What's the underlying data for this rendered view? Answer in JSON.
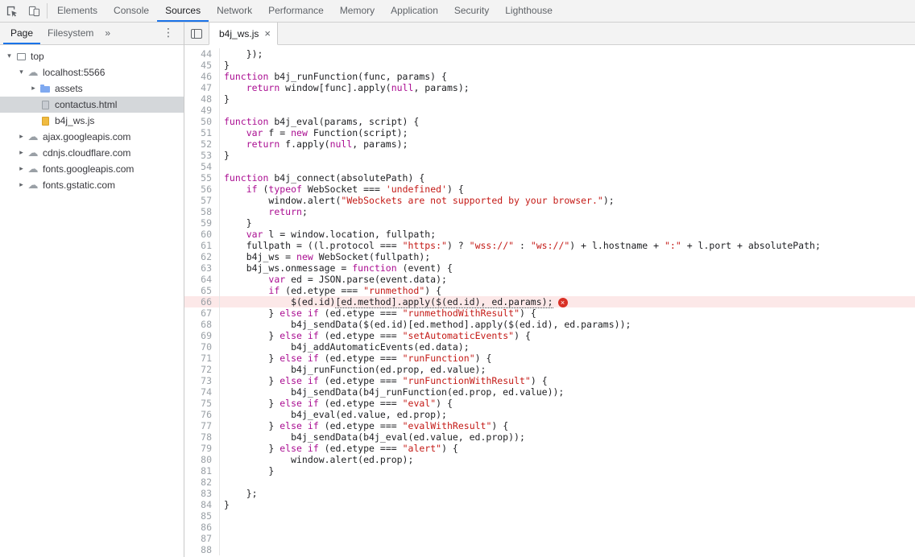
{
  "colors": {
    "accent": "#1a73e8",
    "keyword": "#aa0d91",
    "string": "#c41a16",
    "code_text": "#202124",
    "error_bg": "#fce8e8",
    "error_red": "#d93025",
    "selected_row": "#d4d7da"
  },
  "topbar": {
    "tabs": [
      "Elements",
      "Console",
      "Sources",
      "Network",
      "Performance",
      "Memory",
      "Application",
      "Security",
      "Lighthouse"
    ],
    "active_tab": "Sources"
  },
  "sidebar": {
    "tabs": [
      "Page",
      "Filesystem"
    ],
    "active_tab": "Page",
    "overflow_chevron": "»",
    "menu_glyph": "⋮",
    "tree": [
      {
        "label": "top",
        "level": 0,
        "expander": "open",
        "icon": "frame",
        "selected": false
      },
      {
        "label": "localhost:5566",
        "level": 1,
        "expander": "open",
        "icon": "cloud",
        "selected": false
      },
      {
        "label": "assets",
        "level": 2,
        "expander": "closed",
        "icon": "folder",
        "selected": false
      },
      {
        "label": "contactus.html",
        "level": 2,
        "expander": "none",
        "icon": "file-gray",
        "selected": true
      },
      {
        "label": "b4j_ws.js",
        "level": 2,
        "expander": "none",
        "icon": "file-yellow",
        "selected": false
      },
      {
        "label": "ajax.googleapis.com",
        "level": 1,
        "expander": "closed",
        "icon": "cloud",
        "selected": false
      },
      {
        "label": "cdnjs.cloudflare.com",
        "level": 1,
        "expander": "closed",
        "icon": "cloud",
        "selected": false
      },
      {
        "label": "fonts.googleapis.com",
        "level": 1,
        "expander": "closed",
        "icon": "cloud",
        "selected": false
      },
      {
        "label": "fonts.gstatic.com",
        "level": 1,
        "expander": "closed",
        "icon": "cloud",
        "selected": false
      }
    ]
  },
  "main": {
    "file_tab": {
      "label": "b4j_ws.js",
      "close": "×"
    }
  },
  "editor": {
    "error_line": 66,
    "error_glyph": "×",
    "lines": [
      {
        "n": 44,
        "seg": [
          [
            "p",
            "    });"
          ]
        ]
      },
      {
        "n": 45,
        "seg": [
          [
            "p",
            "}"
          ]
        ]
      },
      {
        "n": 46,
        "seg": [
          [
            "k",
            "function"
          ],
          [
            "p",
            " b4j_runFunction(func, params) {"
          ]
        ]
      },
      {
        "n": 47,
        "seg": [
          [
            "p",
            "    "
          ],
          [
            "k",
            "return"
          ],
          [
            "p",
            " window[func].apply("
          ],
          [
            "k",
            "null"
          ],
          [
            "p",
            ", params);"
          ]
        ]
      },
      {
        "n": 48,
        "seg": [
          [
            "p",
            "}"
          ]
        ]
      },
      {
        "n": 49,
        "seg": []
      },
      {
        "n": 50,
        "seg": [
          [
            "k",
            "function"
          ],
          [
            "p",
            " b4j_eval(params, script) {"
          ]
        ]
      },
      {
        "n": 51,
        "seg": [
          [
            "p",
            "    "
          ],
          [
            "k",
            "var"
          ],
          [
            "p",
            " f = "
          ],
          [
            "k",
            "new"
          ],
          [
            "p",
            " Function(script);"
          ]
        ]
      },
      {
        "n": 52,
        "seg": [
          [
            "p",
            "    "
          ],
          [
            "k",
            "return"
          ],
          [
            "p",
            " f.apply("
          ],
          [
            "k",
            "null"
          ],
          [
            "p",
            ", params);"
          ]
        ]
      },
      {
        "n": 53,
        "seg": [
          [
            "p",
            "}"
          ]
        ]
      },
      {
        "n": 54,
        "seg": []
      },
      {
        "n": 55,
        "seg": [
          [
            "k",
            "function"
          ],
          [
            "p",
            " b4j_connect(absolutePath) {"
          ]
        ]
      },
      {
        "n": 56,
        "seg": [
          [
            "p",
            "    "
          ],
          [
            "k",
            "if"
          ],
          [
            "p",
            " ("
          ],
          [
            "k",
            "typeof"
          ],
          [
            "p",
            " WebSocket === "
          ],
          [
            "s",
            "'undefined'"
          ],
          [
            "p",
            ") {"
          ]
        ]
      },
      {
        "n": 57,
        "seg": [
          [
            "p",
            "        window.alert("
          ],
          [
            "s",
            "\"WebSockets are not supported by your browser.\""
          ],
          [
            "p",
            ");"
          ]
        ]
      },
      {
        "n": 58,
        "seg": [
          [
            "p",
            "        "
          ],
          [
            "k",
            "return"
          ],
          [
            "p",
            ";"
          ]
        ]
      },
      {
        "n": 59,
        "seg": [
          [
            "p",
            "    }"
          ]
        ]
      },
      {
        "n": 60,
        "seg": [
          [
            "p",
            "    "
          ],
          [
            "k",
            "var"
          ],
          [
            "p",
            " l = window.location, fullpath;"
          ]
        ]
      },
      {
        "n": 61,
        "seg": [
          [
            "p",
            "    fullpath = ((l.protocol === "
          ],
          [
            "s",
            "\"https:\""
          ],
          [
            "p",
            ") ? "
          ],
          [
            "s",
            "\"wss://\""
          ],
          [
            "p",
            " : "
          ],
          [
            "s",
            "\"ws://\""
          ],
          [
            "p",
            ") + l.hostname + "
          ],
          [
            "s",
            "\":\""
          ],
          [
            "p",
            " + l.port + absolutePath;"
          ]
        ]
      },
      {
        "n": 62,
        "seg": [
          [
            "p",
            "    b4j_ws = "
          ],
          [
            "k",
            "new"
          ],
          [
            "p",
            " WebSocket(fullpath);"
          ]
        ]
      },
      {
        "n": 63,
        "seg": [
          [
            "p",
            "    b4j_ws.onmessage = "
          ],
          [
            "k",
            "function"
          ],
          [
            "p",
            " (event) {"
          ]
        ]
      },
      {
        "n": 64,
        "seg": [
          [
            "p",
            "        "
          ],
          [
            "k",
            "var"
          ],
          [
            "p",
            " ed = JSON.parse(event.data);"
          ]
        ]
      },
      {
        "n": 65,
        "seg": [
          [
            "p",
            "        "
          ],
          [
            "k",
            "if"
          ],
          [
            "p",
            " (ed.etype === "
          ],
          [
            "s",
            "\"runmethod\""
          ],
          [
            "p",
            ") {"
          ]
        ]
      },
      {
        "n": 66,
        "error": true,
        "seg": [
          [
            "p",
            "            $(ed.id)"
          ],
          [
            "u",
            "[ed.method].apply($(ed.id), ed.params);"
          ]
        ]
      },
      {
        "n": 67,
        "seg": [
          [
            "p",
            "        } "
          ],
          [
            "k",
            "else"
          ],
          [
            "p",
            " "
          ],
          [
            "k",
            "if"
          ],
          [
            "p",
            " (ed.etype === "
          ],
          [
            "s",
            "\"runmethodWithResult\""
          ],
          [
            "p",
            ") {"
          ]
        ]
      },
      {
        "n": 68,
        "seg": [
          [
            "p",
            "            b4j_sendData($(ed.id)[ed.method].apply($(ed.id), ed.params));"
          ]
        ]
      },
      {
        "n": 69,
        "seg": [
          [
            "p",
            "        } "
          ],
          [
            "k",
            "else"
          ],
          [
            "p",
            " "
          ],
          [
            "k",
            "if"
          ],
          [
            "p",
            " (ed.etype === "
          ],
          [
            "s",
            "\"setAutomaticEvents\""
          ],
          [
            "p",
            ") {"
          ]
        ]
      },
      {
        "n": 70,
        "seg": [
          [
            "p",
            "            b4j_addAutomaticEvents(ed.data);"
          ]
        ]
      },
      {
        "n": 71,
        "seg": [
          [
            "p",
            "        } "
          ],
          [
            "k",
            "else"
          ],
          [
            "p",
            " "
          ],
          [
            "k",
            "if"
          ],
          [
            "p",
            " (ed.etype === "
          ],
          [
            "s",
            "\"runFunction\""
          ],
          [
            "p",
            ") {"
          ]
        ]
      },
      {
        "n": 72,
        "seg": [
          [
            "p",
            "            b4j_runFunction(ed.prop, ed.value);"
          ]
        ]
      },
      {
        "n": 73,
        "seg": [
          [
            "p",
            "        } "
          ],
          [
            "k",
            "else"
          ],
          [
            "p",
            " "
          ],
          [
            "k",
            "if"
          ],
          [
            "p",
            " (ed.etype === "
          ],
          [
            "s",
            "\"runFunctionWithResult\""
          ],
          [
            "p",
            ") {"
          ]
        ]
      },
      {
        "n": 74,
        "seg": [
          [
            "p",
            "            b4j_sendData(b4j_runFunction(ed.prop, ed.value));"
          ]
        ]
      },
      {
        "n": 75,
        "seg": [
          [
            "p",
            "        } "
          ],
          [
            "k",
            "else"
          ],
          [
            "p",
            " "
          ],
          [
            "k",
            "if"
          ],
          [
            "p",
            " (ed.etype === "
          ],
          [
            "s",
            "\"eval\""
          ],
          [
            "p",
            ") {"
          ]
        ]
      },
      {
        "n": 76,
        "seg": [
          [
            "p",
            "            b4j_eval(ed.value, ed.prop);"
          ]
        ]
      },
      {
        "n": 77,
        "seg": [
          [
            "p",
            "        } "
          ],
          [
            "k",
            "else"
          ],
          [
            "p",
            " "
          ],
          [
            "k",
            "if"
          ],
          [
            "p",
            " (ed.etype === "
          ],
          [
            "s",
            "\"evalWithResult\""
          ],
          [
            "p",
            ") {"
          ]
        ]
      },
      {
        "n": 78,
        "seg": [
          [
            "p",
            "            b4j_sendData(b4j_eval(ed.value, ed.prop));"
          ]
        ]
      },
      {
        "n": 79,
        "seg": [
          [
            "p",
            "        } "
          ],
          [
            "k",
            "else"
          ],
          [
            "p",
            " "
          ],
          [
            "k",
            "if"
          ],
          [
            "p",
            " (ed.etype === "
          ],
          [
            "s",
            "\"alert\""
          ],
          [
            "p",
            ") {"
          ]
        ]
      },
      {
        "n": 80,
        "seg": [
          [
            "p",
            "            window.alert(ed.prop);"
          ]
        ]
      },
      {
        "n": 81,
        "seg": [
          [
            "p",
            "        }"
          ]
        ]
      },
      {
        "n": 82,
        "seg": []
      },
      {
        "n": 83,
        "seg": [
          [
            "p",
            "    };"
          ]
        ]
      },
      {
        "n": 84,
        "seg": [
          [
            "p",
            "}"
          ]
        ]
      },
      {
        "n": 85,
        "seg": []
      },
      {
        "n": 86,
        "seg": []
      },
      {
        "n": 87,
        "seg": []
      },
      {
        "n": 88,
        "seg": []
      }
    ]
  }
}
